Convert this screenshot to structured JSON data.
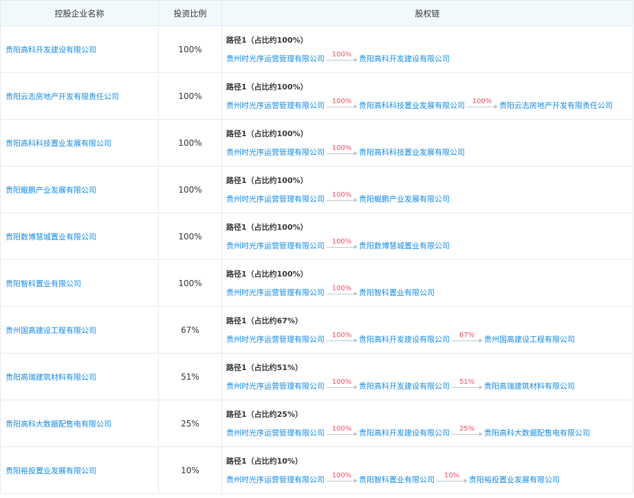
{
  "headers": {
    "company": "控股企业名称",
    "ratio": "投资比例",
    "chain": "股权链"
  },
  "rows": [
    {
      "company": "贵阳高科开发建设有限公司",
      "ratio": "100%",
      "path": "路径1（占比约100%）",
      "nodes": [
        "贵州时光序运营管理有限公司",
        "贵阳高科开发建设有限公司"
      ],
      "percents": [
        "100%"
      ]
    },
    {
      "company": "贵阳云志房地产开发有限责任公司",
      "ratio": "100%",
      "path": "路径1（占比约100%）",
      "nodes": [
        "贵州时光序运营管理有限公司",
        "贵阳高科科技置业发展有限公司",
        "贵阳云志房地产开发有限责任公司"
      ],
      "percents": [
        "100%",
        "100%"
      ]
    },
    {
      "company": "贵阳高科科技置业发展有限公司",
      "ratio": "100%",
      "path": "路径1（占比约100%）",
      "nodes": [
        "贵州时光序运营管理有限公司",
        "贵阳高科科技置业发展有限公司"
      ],
      "percents": [
        "100%"
      ]
    },
    {
      "company": "贵阳鲲鹏产业发展有限公司",
      "ratio": "100%",
      "path": "路径1（占比约100%）",
      "nodes": [
        "贵州时光序运营管理有限公司",
        "贵阳鲲鹏产业发展有限公司"
      ],
      "percents": [
        "100%"
      ]
    },
    {
      "company": "贵阳数博慧城置业有限公司",
      "ratio": "100%",
      "path": "路径1（占比约100%）",
      "nodes": [
        "贵州时光序运营管理有限公司",
        "贵阳数博慧城置业有限公司"
      ],
      "percents": [
        "100%"
      ]
    },
    {
      "company": "贵阳智科置业有限公司",
      "ratio": "100%",
      "path": "路径1（占比约100%）",
      "nodes": [
        "贵州时光序运营管理有限公司",
        "贵阳智科置业有限公司"
      ],
      "percents": [
        "100%"
      ]
    },
    {
      "company": "贵州国高建设工程有限公司",
      "ratio": "67%",
      "path": "路径1（占比约67%）",
      "nodes": [
        "贵州时光序运营管理有限公司",
        "贵阳高科开发建设有限公司",
        "贵州国高建设工程有限公司"
      ],
      "percents": [
        "100%",
        "67%"
      ]
    },
    {
      "company": "贵阳高瑞建筑材料有限公司",
      "ratio": "51%",
      "path": "路径1（占比约51%）",
      "nodes": [
        "贵州时光序运营管理有限公司",
        "贵阳高科开发建设有限公司",
        "贵阳高瑞建筑材料有限公司"
      ],
      "percents": [
        "100%",
        "51%"
      ]
    },
    {
      "company": "贵阳高科大数据配售电有限公司",
      "ratio": "25%",
      "path": "路径1（占比约25%）",
      "nodes": [
        "贵州时光序运营管理有限公司",
        "贵阳高科开发建设有限公司",
        "贵阳高科大数据配售电有限公司"
      ],
      "percents": [
        "100%",
        "25%"
      ]
    },
    {
      "company": "贵阳裕投置业发展有限公司",
      "ratio": "10%",
      "path": "路径1（占比约10%）",
      "nodes": [
        "贵州时光序运营管理有限公司",
        "贵阳智科置业有限公司",
        "贵阳裕投置业发展有限公司"
      ],
      "percents": [
        "100%",
        "10%"
      ]
    }
  ]
}
